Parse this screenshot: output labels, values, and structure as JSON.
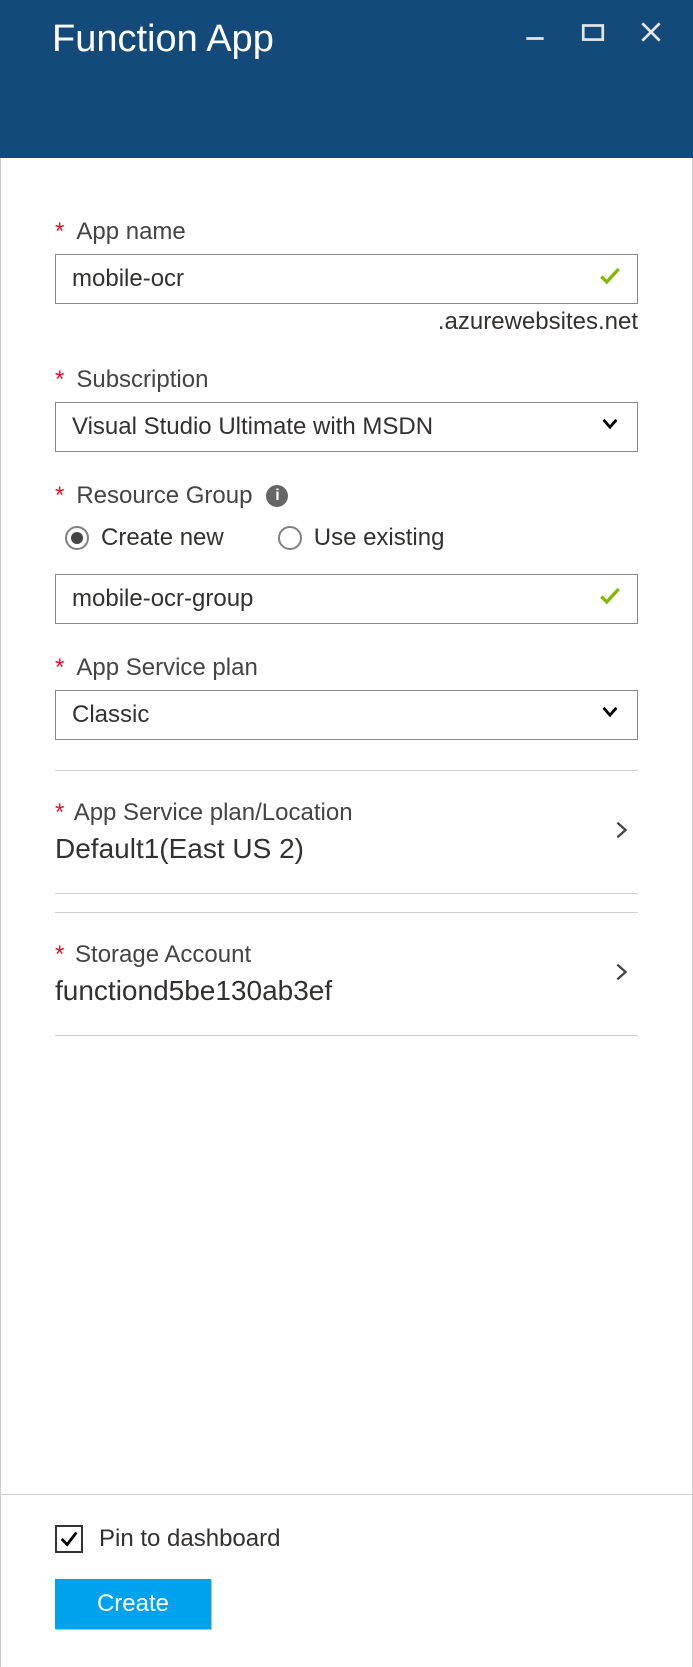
{
  "header": {
    "title": "Function App"
  },
  "appName": {
    "label": "App name",
    "value": "mobile-ocr",
    "suffix": ".azurewebsites.net"
  },
  "subscription": {
    "label": "Subscription",
    "value": "Visual Studio Ultimate with MSDN"
  },
  "resourceGroup": {
    "label": "Resource Group",
    "options": {
      "createNew": "Create new",
      "useExisting": "Use existing"
    },
    "selected": "createNew",
    "value": "mobile-ocr-group"
  },
  "appServicePlan": {
    "label": "App Service plan",
    "value": "Classic"
  },
  "appServicePlanLocation": {
    "label": "App Service plan/Location",
    "value": "Default1(East US 2)"
  },
  "storageAccount": {
    "label": "Storage Account",
    "value": "functiond5be130ab3ef"
  },
  "footer": {
    "pinLabel": "Pin to dashboard",
    "pinChecked": true,
    "createLabel": "Create"
  }
}
